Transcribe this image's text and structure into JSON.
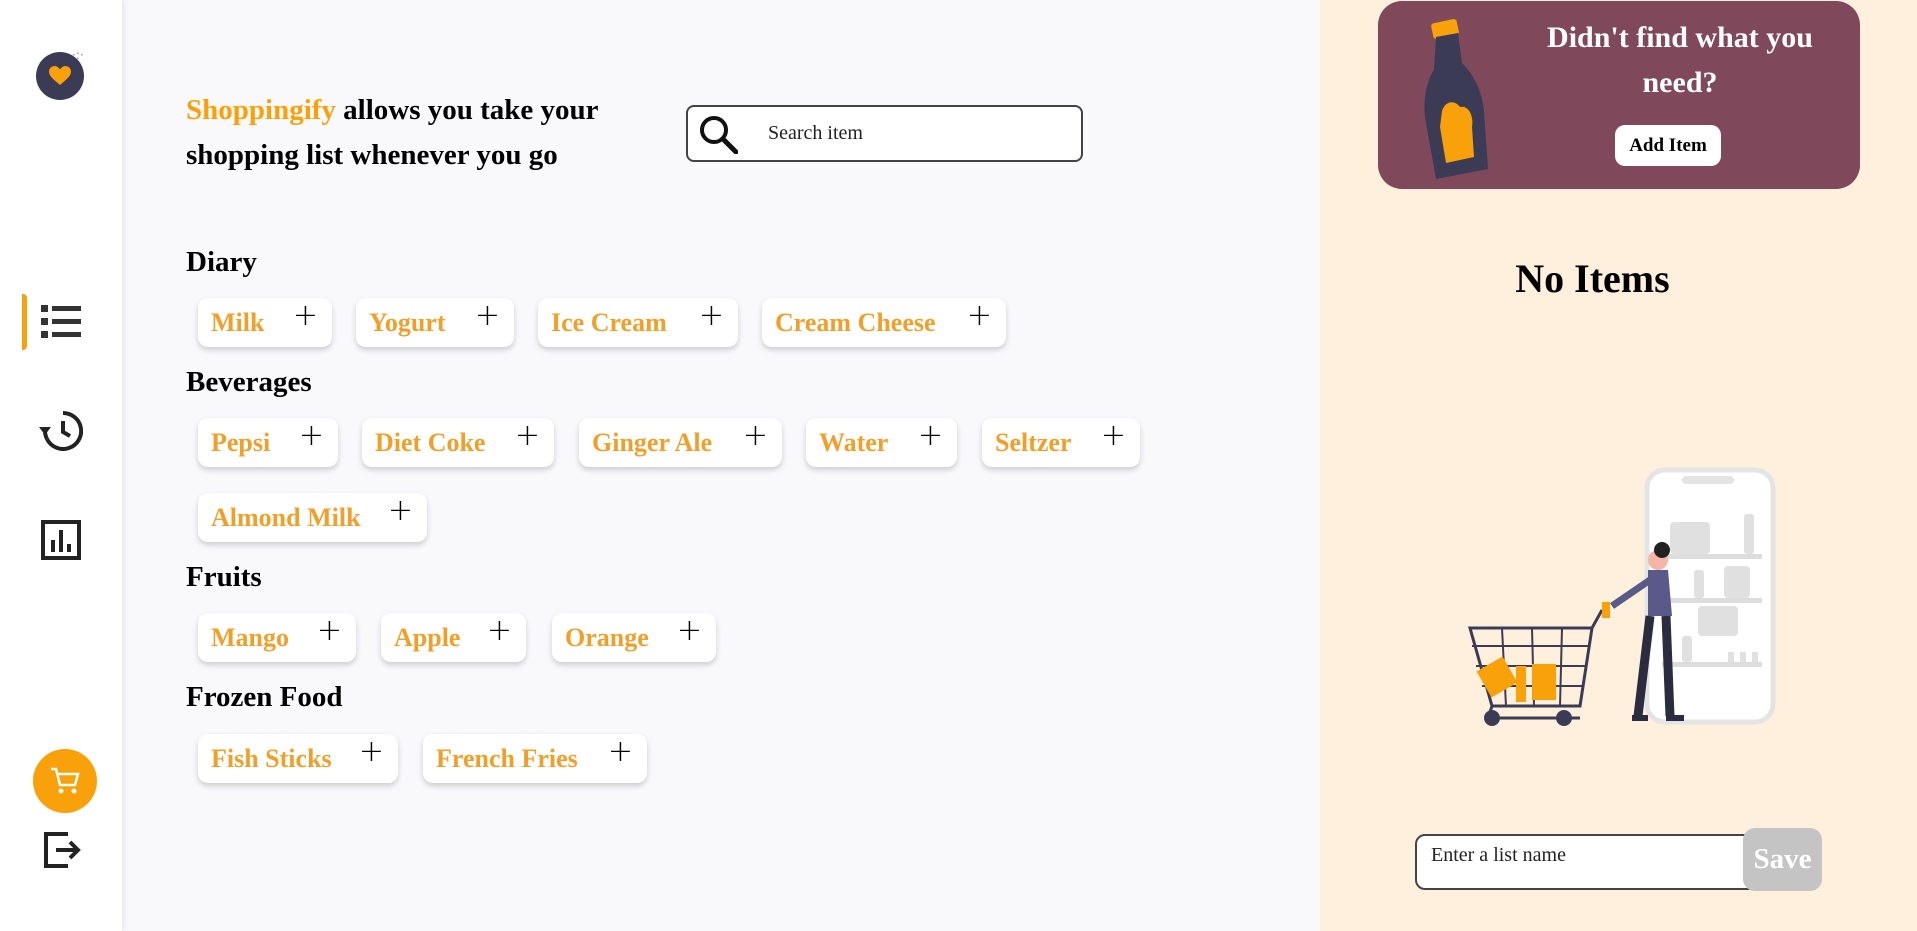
{
  "brand": {
    "name": "Shoppingify",
    "tagline_rest": " allows you take your shopping list whenever you go"
  },
  "search": {
    "placeholder": "Search item"
  },
  "nav": [
    {
      "name": "list-icon"
    },
    {
      "name": "history-icon"
    },
    {
      "name": "statistics-icon"
    }
  ],
  "categories": [
    {
      "title": "Diary",
      "items": [
        "Milk",
        "Yogurt",
        "Ice Cream",
        "Cream Cheese"
      ]
    },
    {
      "title": "Beverages",
      "items": [
        "Pepsi",
        "Diet Coke",
        "Ginger Ale",
        "Water",
        "Seltzer",
        "Almond Milk"
      ]
    },
    {
      "title": "Fruits",
      "items": [
        "Mango",
        "Apple",
        "Orange"
      ]
    },
    {
      "title": "Frozen Food",
      "items": [
        "Fish Sticks",
        "French Fries"
      ]
    }
  ],
  "plus_symbol": "+",
  "banner": {
    "question": "Didn't find what you need?",
    "add_label": "Add Item"
  },
  "cart": {
    "empty_text": "No Items"
  },
  "save_form": {
    "placeholder": "Enter a list name",
    "save_label": "Save"
  },
  "colors": {
    "accent": "#f9a10a",
    "banner": "#80485b",
    "panel": "#fff0de",
    "item_text": "#f0a02a"
  }
}
